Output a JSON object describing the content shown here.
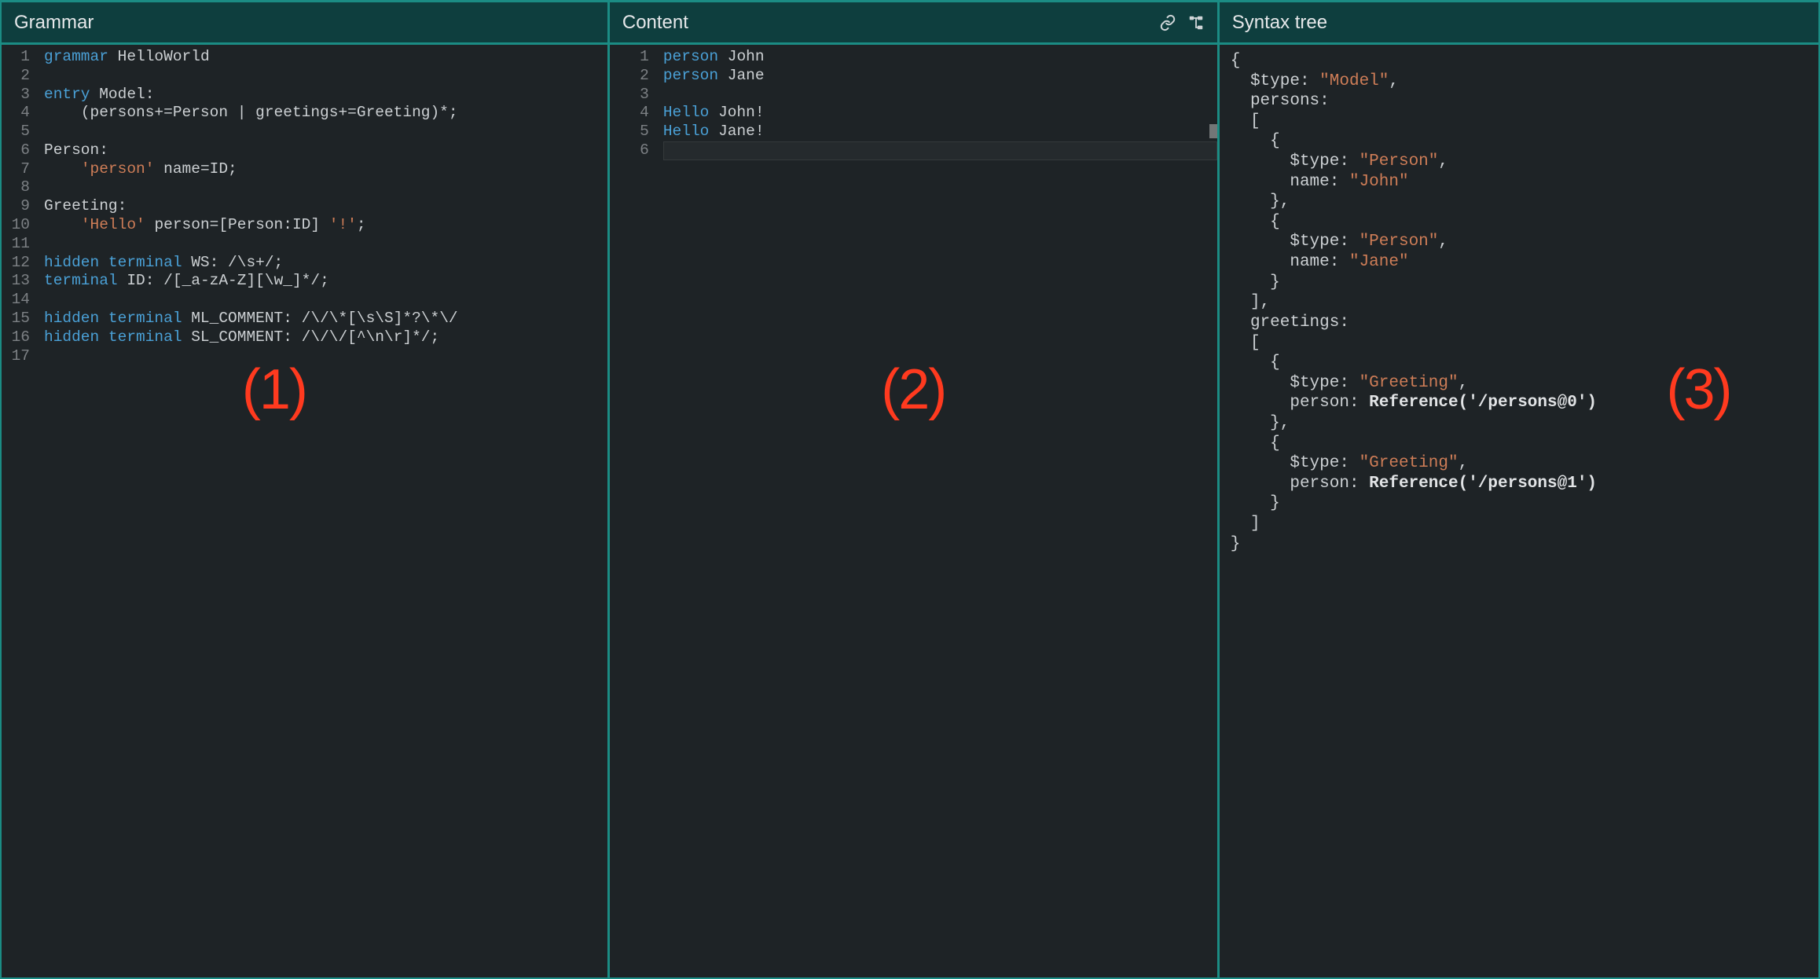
{
  "panes": {
    "grammar": {
      "title": "Grammar",
      "annotation": "(1)",
      "line_count": 17,
      "code": {
        "l1": [
          [
            "kw",
            "grammar"
          ],
          [
            "sp",
            " "
          ],
          [
            "ident",
            "HelloWorld"
          ]
        ],
        "l2": [],
        "l3": [
          [
            "kw",
            "entry"
          ],
          [
            "sp",
            " "
          ],
          [
            "ident",
            "Model:"
          ]
        ],
        "l4": [
          [
            "sp",
            "    "
          ],
          [
            "punc",
            "(persons+=Person | greetings+=Greeting)*;"
          ]
        ],
        "l5": [],
        "l6": [
          [
            "ident",
            "Person:"
          ]
        ],
        "l7": [
          [
            "sp",
            "    "
          ],
          [
            "str",
            "'person'"
          ],
          [
            "sp",
            " "
          ],
          [
            "punc",
            "name=ID;"
          ]
        ],
        "l8": [],
        "l9": [
          [
            "ident",
            "Greeting:"
          ]
        ],
        "l10": [
          [
            "sp",
            "    "
          ],
          [
            "str",
            "'Hello'"
          ],
          [
            "sp",
            " "
          ],
          [
            "punc",
            "person=[Person:ID] "
          ],
          [
            "str",
            "'!'"
          ],
          [
            "punc",
            ";"
          ]
        ],
        "l11": [],
        "l12": [
          [
            "kw",
            "hidden terminal"
          ],
          [
            "sp",
            " "
          ],
          [
            "ident",
            "WS:"
          ],
          [
            "sp",
            " "
          ],
          [
            "punc",
            "/\\s+/;"
          ]
        ],
        "l13": [
          [
            "kw",
            "terminal"
          ],
          [
            "sp",
            " "
          ],
          [
            "ident",
            "ID:"
          ],
          [
            "sp",
            " "
          ],
          [
            "punc",
            "/[_a-zA-Z][\\w_]*/;"
          ]
        ],
        "l14": [],
        "l15": [
          [
            "kw",
            "hidden terminal"
          ],
          [
            "sp",
            " "
          ],
          [
            "ident",
            "ML_COMMENT:"
          ],
          [
            "sp",
            " "
          ],
          [
            "punc",
            "/\\/\\*[\\s\\S]*?\\*\\/"
          ]
        ],
        "l16": [
          [
            "kw",
            "hidden terminal"
          ],
          [
            "sp",
            " "
          ],
          [
            "ident",
            "SL_COMMENT:"
          ],
          [
            "sp",
            " "
          ],
          [
            "punc",
            "/\\/\\/[^\\n\\r]*/;"
          ]
        ],
        "l17": []
      }
    },
    "content": {
      "title": "Content",
      "annotation": "(2)",
      "line_count": 6,
      "active_line": 6,
      "code": {
        "l1": [
          [
            "kw",
            "person"
          ],
          [
            "sp",
            " "
          ],
          [
            "ident",
            "John"
          ]
        ],
        "l2": [
          [
            "kw",
            "person"
          ],
          [
            "sp",
            " "
          ],
          [
            "ident",
            "Jane"
          ]
        ],
        "l3": [],
        "l4": [
          [
            "kw",
            "Hello"
          ],
          [
            "sp",
            " "
          ],
          [
            "ident",
            "John!"
          ]
        ],
        "l5": [
          [
            "kw",
            "Hello"
          ],
          [
            "sp",
            " "
          ],
          [
            "ident",
            "Jane!"
          ]
        ],
        "l6": []
      }
    },
    "syntax": {
      "title": "Syntax tree",
      "annotation": "(3)",
      "tree": [
        [
          [
            "punc",
            "{"
          ]
        ],
        [
          [
            "sp",
            "  "
          ],
          [
            "key",
            "$type: "
          ],
          [
            "strval",
            "\"Model\""
          ],
          [
            "punc",
            ","
          ]
        ],
        [
          [
            "sp",
            "  "
          ],
          [
            "key",
            "persons:"
          ]
        ],
        [
          [
            "sp",
            "  "
          ],
          [
            "punc",
            "["
          ]
        ],
        [
          [
            "sp",
            "    "
          ],
          [
            "punc",
            "{"
          ]
        ],
        [
          [
            "sp",
            "      "
          ],
          [
            "key",
            "$type: "
          ],
          [
            "strval",
            "\"Person\""
          ],
          [
            "punc",
            ","
          ]
        ],
        [
          [
            "sp",
            "      "
          ],
          [
            "key",
            "name: "
          ],
          [
            "strval",
            "\"John\""
          ]
        ],
        [
          [
            "sp",
            "    "
          ],
          [
            "punc",
            "},"
          ]
        ],
        [
          [
            "sp",
            "    "
          ],
          [
            "punc",
            "{"
          ]
        ],
        [
          [
            "sp",
            "      "
          ],
          [
            "key",
            "$type: "
          ],
          [
            "strval",
            "\"Person\""
          ],
          [
            "punc",
            ","
          ]
        ],
        [
          [
            "sp",
            "      "
          ],
          [
            "key",
            "name: "
          ],
          [
            "strval",
            "\"Jane\""
          ]
        ],
        [
          [
            "sp",
            "    "
          ],
          [
            "punc",
            "}"
          ]
        ],
        [
          [
            "sp",
            "  "
          ],
          [
            "punc",
            "],"
          ]
        ],
        [
          [
            "sp",
            "  "
          ],
          [
            "key",
            "greetings:"
          ]
        ],
        [
          [
            "sp",
            "  "
          ],
          [
            "punc",
            "["
          ]
        ],
        [
          [
            "sp",
            "    "
          ],
          [
            "punc",
            "{"
          ]
        ],
        [
          [
            "sp",
            "      "
          ],
          [
            "key",
            "$type: "
          ],
          [
            "strval",
            "\"Greeting\""
          ],
          [
            "punc",
            ","
          ]
        ],
        [
          [
            "sp",
            "      "
          ],
          [
            "key",
            "person: "
          ],
          [
            "bold",
            "Reference('/persons@0')"
          ]
        ],
        [
          [
            "sp",
            "    "
          ],
          [
            "punc",
            "},"
          ]
        ],
        [
          [
            "sp",
            "    "
          ],
          [
            "punc",
            "{"
          ]
        ],
        [
          [
            "sp",
            "      "
          ],
          [
            "key",
            "$type: "
          ],
          [
            "strval",
            "\"Greeting\""
          ],
          [
            "punc",
            ","
          ]
        ],
        [
          [
            "sp",
            "      "
          ],
          [
            "key",
            "person: "
          ],
          [
            "bold",
            "Reference('/persons@1')"
          ]
        ],
        [
          [
            "sp",
            "    "
          ],
          [
            "punc",
            "}"
          ]
        ],
        [
          [
            "sp",
            "  "
          ],
          [
            "punc",
            "]"
          ]
        ],
        [
          [
            "punc",
            "}"
          ]
        ]
      ]
    }
  },
  "icons": {
    "link": "link-icon",
    "tree": "tree-icon"
  }
}
